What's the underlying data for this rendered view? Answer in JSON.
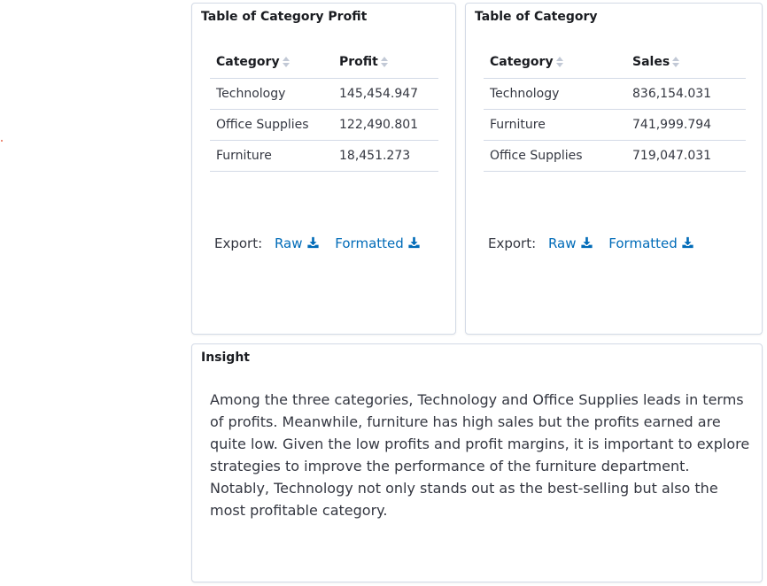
{
  "profit_panel": {
    "title": "Table of Category Profit",
    "columns": [
      "Category",
      "Profit"
    ],
    "rows": [
      [
        "Technology",
        "145,454.947"
      ],
      [
        "Office Supplies",
        "122,490.801"
      ],
      [
        "Furniture",
        "18,451.273"
      ]
    ],
    "export": {
      "label": "Export:",
      "raw": "Raw",
      "formatted": "Formatted"
    }
  },
  "sales_panel": {
    "title": "Table of Category",
    "columns": [
      "Category",
      "Sales"
    ],
    "rows": [
      [
        "Technology",
        "836,154.031"
      ],
      [
        "Furniture",
        "741,999.794"
      ],
      [
        "Office Supplies",
        "719,047.031"
      ]
    ],
    "export": {
      "label": "Export:",
      "raw": "Raw",
      "formatted": "Formatted"
    }
  },
  "insight_panel": {
    "title": "Insight",
    "text": "Among the three categories, Technology and Office Supplies leads in terms of profits. Meanwhile, furniture has high sales but the profits earned are quite low. Given the low profits and profit margins, it is important to explore strategies to improve the performance of the furniture department. Notably, Technology not only stands out as the best-selling but also the most profitable category."
  },
  "colors": {
    "link": "#006bb8",
    "border": "#d3dae6",
    "accent_dot": "#e7664c"
  },
  "icons": {
    "sort": "sort-icon",
    "download": "download-icon"
  }
}
